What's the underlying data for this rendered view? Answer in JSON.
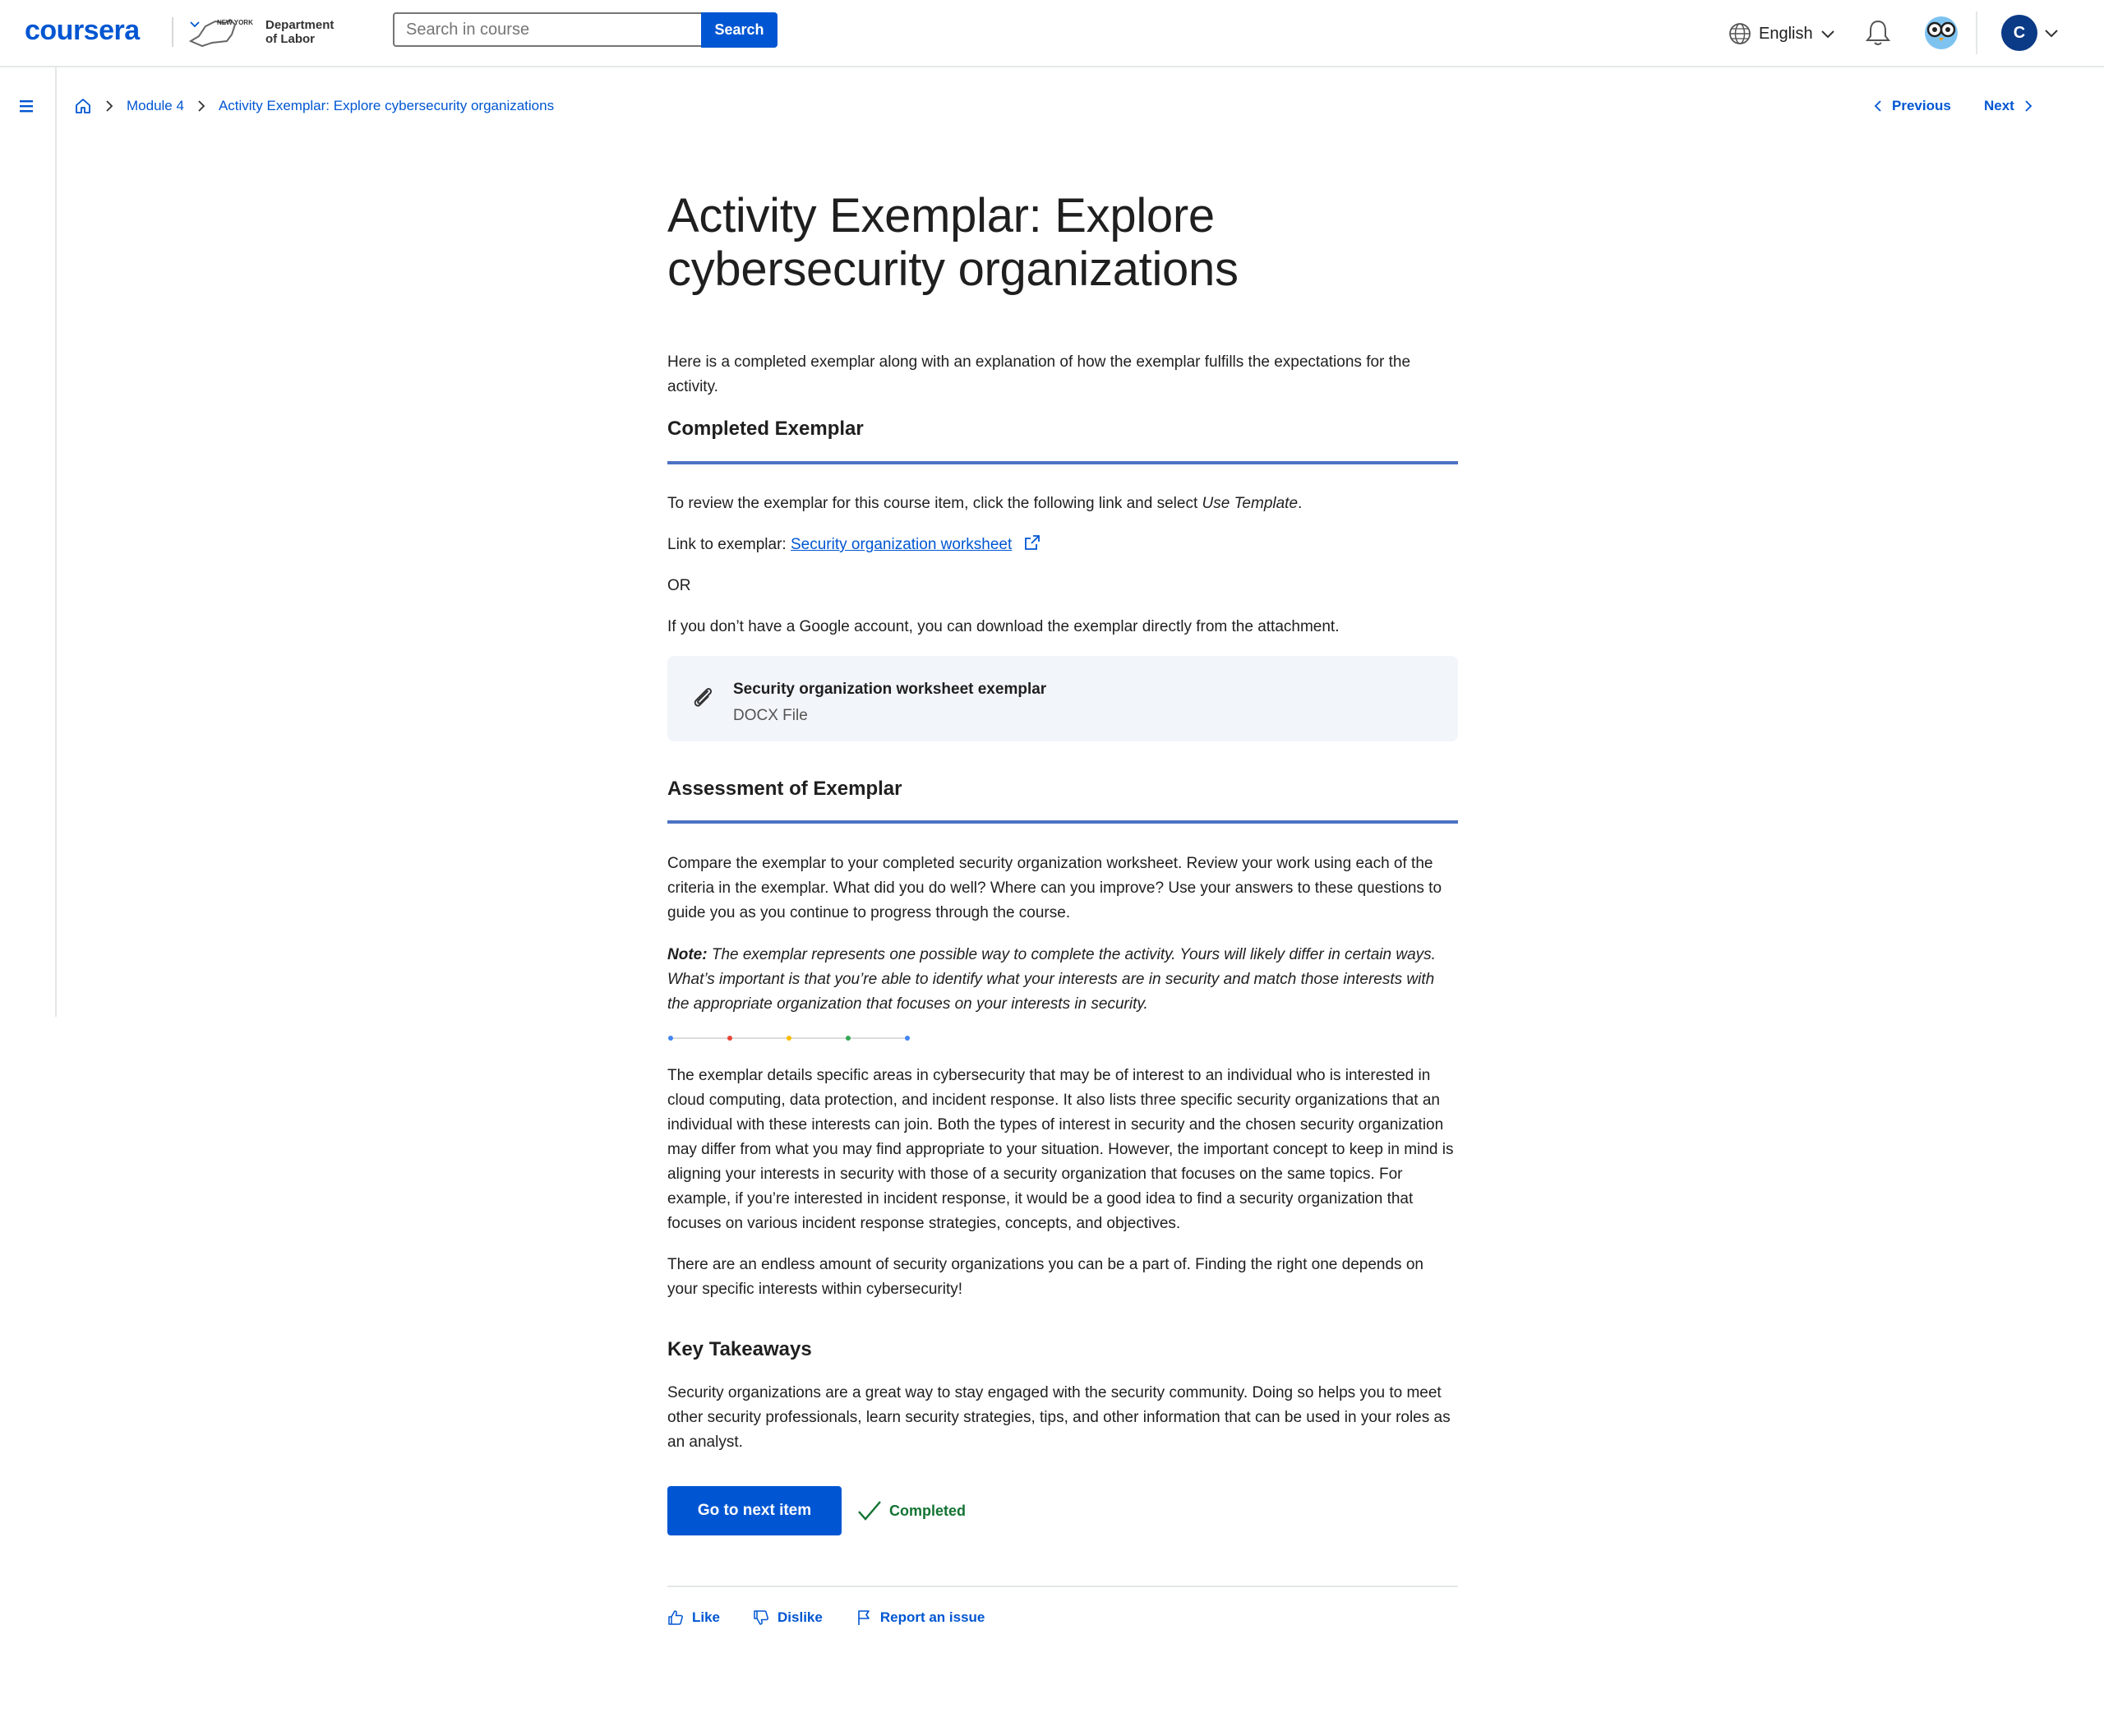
{
  "header": {
    "logo": "coursera",
    "partner_line1": "Department",
    "partner_line2": "of Labor",
    "partner_state": "NEW YORK",
    "search_placeholder": "Search in course",
    "search_button": "Search",
    "language": "English",
    "avatar_initial": "C"
  },
  "nav": {
    "breadcrumb": [
      "Module 4",
      "Activity Exemplar: Explore cybersecurity organizations"
    ],
    "previous": "Previous",
    "next": "Next"
  },
  "article": {
    "title": "Activity Exemplar: Explore cybersecurity organizations",
    "intro": "Here is a completed exemplar along with an explanation of how the exemplar fulfills the expectations for the activity.",
    "section1_heading": "Completed Exemplar",
    "review_text_prefix": "To review the exemplar for this course item, click the following link and select ",
    "review_text_em": "Use Template",
    "review_text_suffix": ".",
    "link_prefix": "Link to exemplar: ",
    "link_text": "Security organization worksheet",
    "or_text": "OR",
    "no_google_text": "If you don’t have a Google account, you can download the exemplar directly from the attachment.",
    "attachment": {
      "name": "Security organization worksheet exemplar",
      "type": "DOCX File"
    },
    "section2_heading": "Assessment of Exemplar",
    "compare_text": "Compare the exemplar to your completed security organization worksheet. Review your work using each of the criteria in the exemplar. What did you do well? Where can you improve? Use your answers to these questions to guide you as you continue to progress through the course.",
    "note_label": "Note:",
    "note_text": " The exemplar represents one possible way to complete the activity. Yours will likely differ in certain ways. What’s important is that you’re able to identify what your interests are in security and match those interests with the appropriate organization that focuses on your interests in security.",
    "details_text": "The exemplar details specific areas in cybersecurity that may be of interest to an individual who is interested in cloud computing, data protection, and incident response. It also lists three specific security organizations that an individual with these interests can join. Both the types of interest in security and the chosen security organization may differ from what you may find appropriate to your situation. However, the important concept to keep in mind is aligning your interests in security with those of a security organization that focuses on the same topics. For example, if you’re interested in incident response, it would be a good idea to find a security organization that focuses on various incident response strategies, concepts, and objectives.",
    "endless_text": "There are an endless amount of security organizations you can be a part of. Finding the right one depends on your specific interests within cybersecurity!",
    "section3_heading": "Key Takeaways",
    "takeaways_text": "Security organizations are a great way to stay engaged with the security community. Doing so helps you to meet other security professionals, learn security strategies, tips, and other information that can be used in your roles as an analyst."
  },
  "footer_actions": {
    "next_item_button": "Go to next item",
    "completed_label": "Completed",
    "like": "Like",
    "dislike": "Dislike",
    "report": "Report an issue"
  },
  "colors": {
    "brand_blue": "#0056d2",
    "section_rule": "#4c72c4",
    "completed_green": "#137333",
    "attachment_bg": "#f2f5fa",
    "divider_dots": [
      "#4285f4",
      "#ea4335",
      "#fbbc04",
      "#34a853",
      "#4285f4"
    ]
  }
}
